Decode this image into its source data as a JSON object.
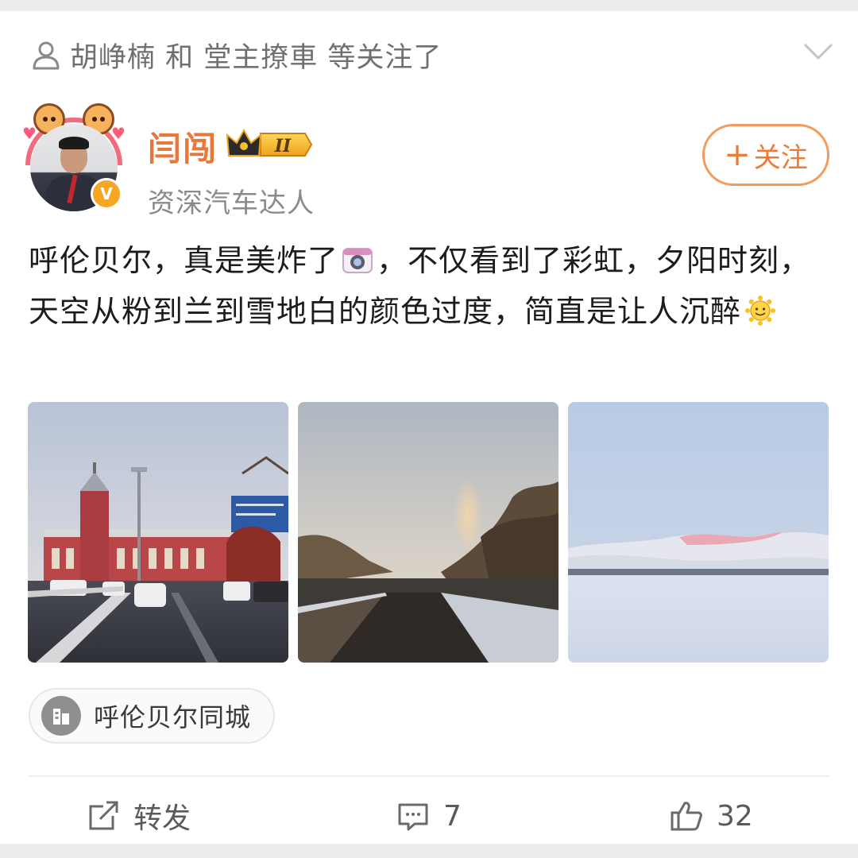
{
  "followed_bar": {
    "text": "胡峥楠 和 堂主撩車 等关注了"
  },
  "author": {
    "name": "闫闯",
    "description": "资深汽车达人",
    "vip_level": "II",
    "verified_mark": "V"
  },
  "follow_button": {
    "plus": "+",
    "label": "关注"
  },
  "post": {
    "text_part1": "呼伦贝尔，真是美炸了",
    "text_part2": "，不仅看到了彩虹，夕阳时刻，天空从粉到兰到雪地白的颜色过度，简直是让人沉醉",
    "emoji_1": "camera-emoji",
    "emoji_2": "sun-smile-emoji"
  },
  "location": {
    "label": "呼伦贝尔同城"
  },
  "actions": {
    "repost_label": "转发",
    "comment_count": "7",
    "like_count": "32"
  },
  "colors": {
    "author_name": "#e8773a",
    "follow_border": "#f39b5a",
    "secondary_text": "#8a8a8a"
  }
}
